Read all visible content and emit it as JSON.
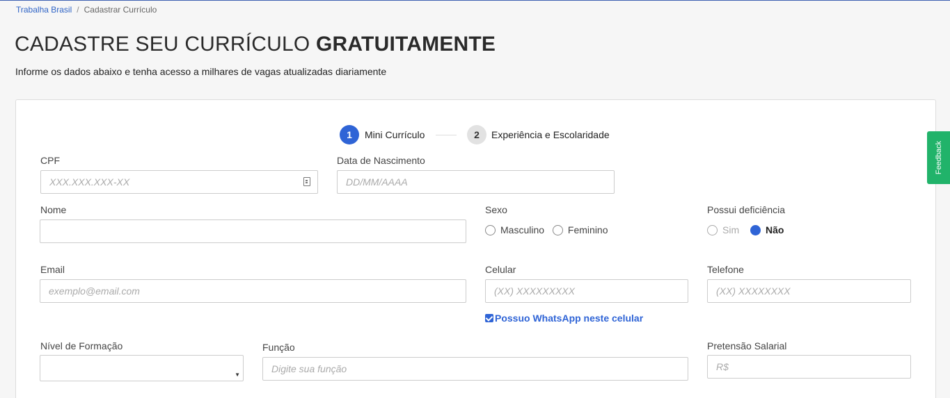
{
  "breadcrumb": {
    "home": "Trabalha Brasil",
    "separator": "/",
    "current": "Cadastrar Currículo"
  },
  "header": {
    "title_light": "CADASTRE SEU CURRÍCULO",
    "title_bold": "GRATUITAMENTE",
    "subtitle": "Informe os dados abaixo e tenha acesso a milhares de vagas atualizadas diariamente"
  },
  "stepper": {
    "steps": [
      {
        "number": "1",
        "label": "Mini Currículo",
        "active": true
      },
      {
        "number": "2",
        "label": "Experiência e Escolaridade",
        "active": false
      }
    ]
  },
  "form": {
    "cpf": {
      "label": "CPF",
      "placeholder": "XXX.XXX.XXX-XX",
      "icon": "id-card-icon"
    },
    "birth": {
      "label": "Data de Nascimento",
      "placeholder": "DD/MM/AAAA"
    },
    "name": {
      "label": "Nome",
      "value": ""
    },
    "sex": {
      "label": "Sexo",
      "options": [
        "Masculino",
        "Feminino"
      ],
      "selected": null
    },
    "disability": {
      "label": "Possui deficiência",
      "options": [
        "Sim",
        "Não"
      ],
      "selected": "Não"
    },
    "email": {
      "label": "Email",
      "placeholder": "exemplo@email.com"
    },
    "mobile": {
      "label": "Celular",
      "placeholder": "(XX) XXXXXXXXX"
    },
    "whatsapp": {
      "label": "Possuo WhatsApp neste celular",
      "checked": true
    },
    "phone": {
      "label": "Telefone",
      "placeholder": "(XX) XXXXXXXX"
    },
    "education": {
      "label": "Nível de Formação",
      "value": ""
    },
    "role": {
      "label": "Função",
      "placeholder": "Digite sua função"
    },
    "salary": {
      "label": "Pretensão Salarial",
      "placeholder": "R$"
    }
  },
  "feedback": {
    "label": "Feedback"
  },
  "colors": {
    "accent": "#2f64d6",
    "feedback": "#21b36a",
    "link": "#2f64c6"
  }
}
